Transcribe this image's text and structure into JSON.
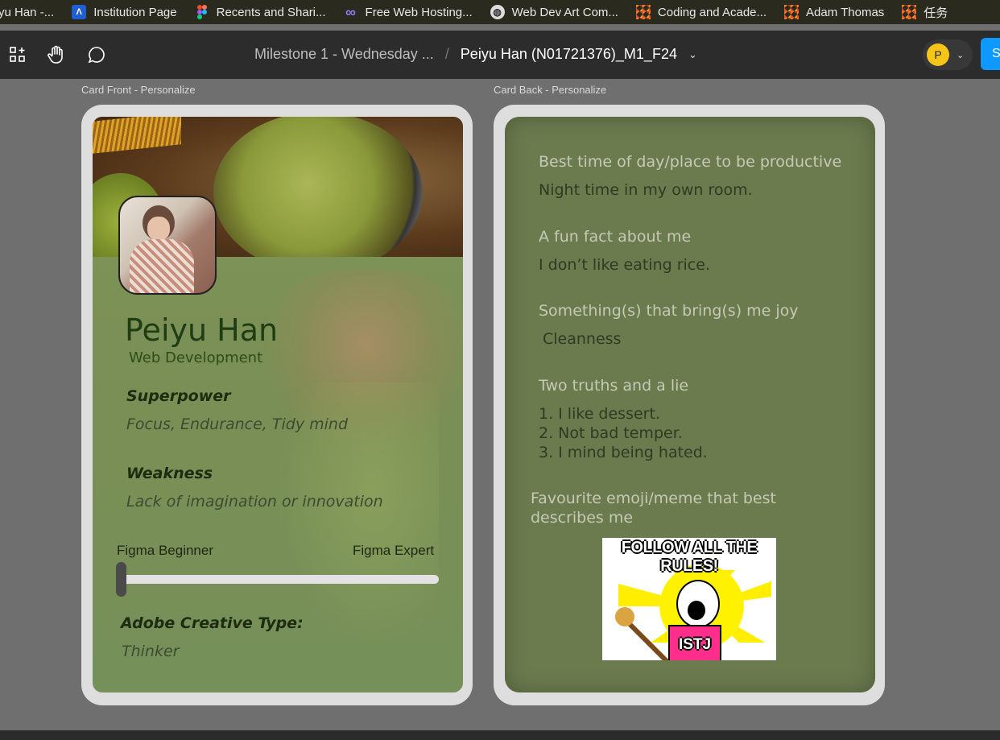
{
  "bookmarks": [
    {
      "label": "yu Han -...",
      "icon": "page-icon"
    },
    {
      "label": "Institution Page",
      "icon": "institution-icon"
    },
    {
      "label": "Recents and Shari...",
      "icon": "figma-icon"
    },
    {
      "label": "Free Web Hosting...",
      "icon": "infinity-icon"
    },
    {
      "label": "Web Dev Art Com...",
      "icon": "globe-icon"
    },
    {
      "label": "Coding and Acade...",
      "icon": "pixel-art-icon"
    },
    {
      "label": "Adam Thomas",
      "icon": "pixel-art-icon"
    },
    {
      "label": "任务",
      "icon": "pixel-art-icon"
    }
  ],
  "toolbar": {
    "file_name": "Milestone 1 - Wednesday ...",
    "separator": "/",
    "page_name": "Peiyu Han (N01721376)_M1_F24",
    "avatar_initial": "P",
    "share_label": "S"
  },
  "frames": {
    "front_label": "Card Front - Personalize",
    "back_label": "Card Back - Personalize"
  },
  "front": {
    "name": "Peiyu Han",
    "role": "Web Development",
    "superpower_label": "Superpower",
    "superpower_value": "Focus, Endurance, Tidy mind",
    "weakness_label": "Weakness",
    "weakness_value": "Lack of imagination or innovation",
    "slider_min_label": "Figma Beginner",
    "slider_max_label": "Figma Expert",
    "figma_skill_level": 0.0,
    "adobe_label": "Adobe Creative Type:",
    "adobe_value": "Thinker"
  },
  "back": {
    "q1": "Best time of day/place to be productive",
    "a1": "Night time in my own room.",
    "q2": "A fun fact about me",
    "a2": "I don’t like eating rice.",
    "q3": "Something(s) that bring(s) me joy",
    "a3": "Cleanness",
    "q4": "Two truths and a lie",
    "a4": [
      "1. I like dessert.",
      "2. Not bad temper.",
      "3. I mind being hated."
    ],
    "q5": "Favourite emoji/meme that best describes me",
    "meme_title": "FOLLOW ALL THE RULES!",
    "meme_label": "ISTJ"
  },
  "colors": {
    "figma_toolbar": "#2c2c2c",
    "canvas": "#6f6f6f",
    "card_border": "#dedede",
    "card_green": "#7a8f55",
    "share_blue": "#0d99ff",
    "avatar_yellow": "#f5c518"
  }
}
